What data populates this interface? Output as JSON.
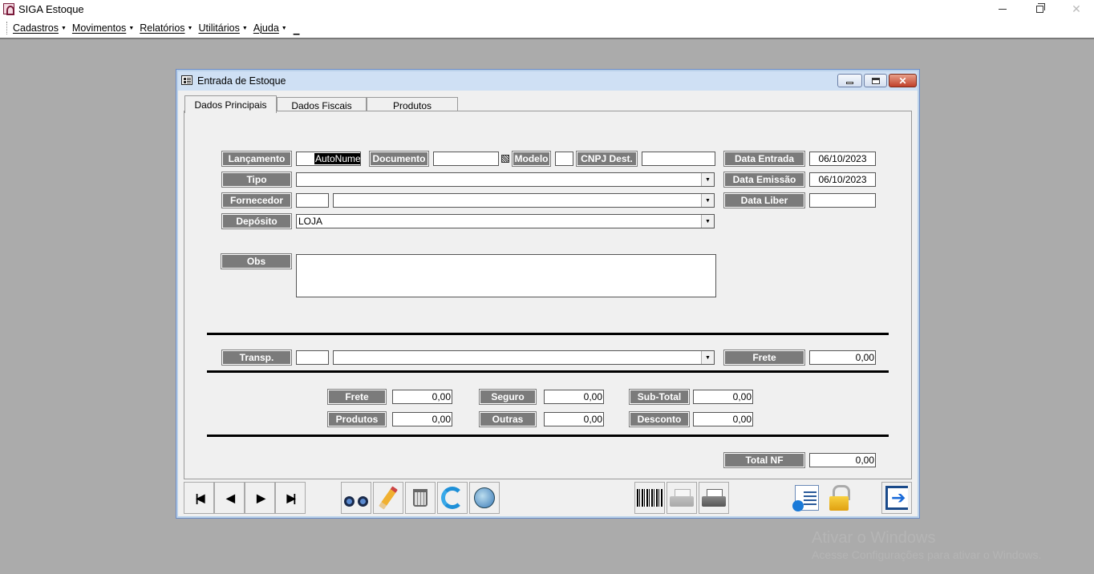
{
  "app": {
    "title": "SIGA Estoque"
  },
  "menu": {
    "items": [
      "Cadastros",
      "Movimentos",
      "Relatórios",
      "Utilitários",
      "Ajuda"
    ]
  },
  "window": {
    "title": "Entrada de Estoque"
  },
  "tabs": [
    "Dados Principais",
    "Dados Fiscais",
    "Produtos"
  ],
  "form": {
    "lancamento": {
      "label": "Lançamento",
      "value": "AutoNumer"
    },
    "documento": {
      "label": "Documento",
      "value": ""
    },
    "modelo": {
      "label": "Modelo",
      "value": ""
    },
    "cnpj_dest": {
      "label": "CNPJ Dest.",
      "value": ""
    },
    "data_entrada": {
      "label": "Data Entrada",
      "value": "06/10/2023"
    },
    "tipo": {
      "label": "Tipo",
      "value": ""
    },
    "data_emissao": {
      "label": "Data Emissão",
      "value": "06/10/2023"
    },
    "fornecedor": {
      "label": "Fornecedor",
      "code": "",
      "value": ""
    },
    "data_liber": {
      "label": "Data Liber",
      "value": ""
    },
    "deposito": {
      "label": "Depósito",
      "value": "LOJA"
    },
    "obs": {
      "label": "Obs",
      "value": ""
    },
    "transp": {
      "label": "Transp.",
      "code": "",
      "value": ""
    },
    "frete_transp": {
      "label": "Frete",
      "value": "0,00"
    }
  },
  "totals": {
    "frete": {
      "label": "Frete",
      "value": "0,00"
    },
    "seguro": {
      "label": "Seguro",
      "value": "0,00"
    },
    "subtotal": {
      "label": "Sub-Total",
      "value": "0,00"
    },
    "produtos": {
      "label": "Produtos",
      "value": "0,00"
    },
    "outras": {
      "label": "Outras",
      "value": "0,00"
    },
    "desconto": {
      "label": "Desconto",
      "value": "0,00"
    },
    "total_nf": {
      "label": "Total NF",
      "value": "0,00"
    }
  },
  "watermark": {
    "line1": "Ativar o Windows",
    "line2": "Acesse Configurações para ativar o Windows."
  }
}
